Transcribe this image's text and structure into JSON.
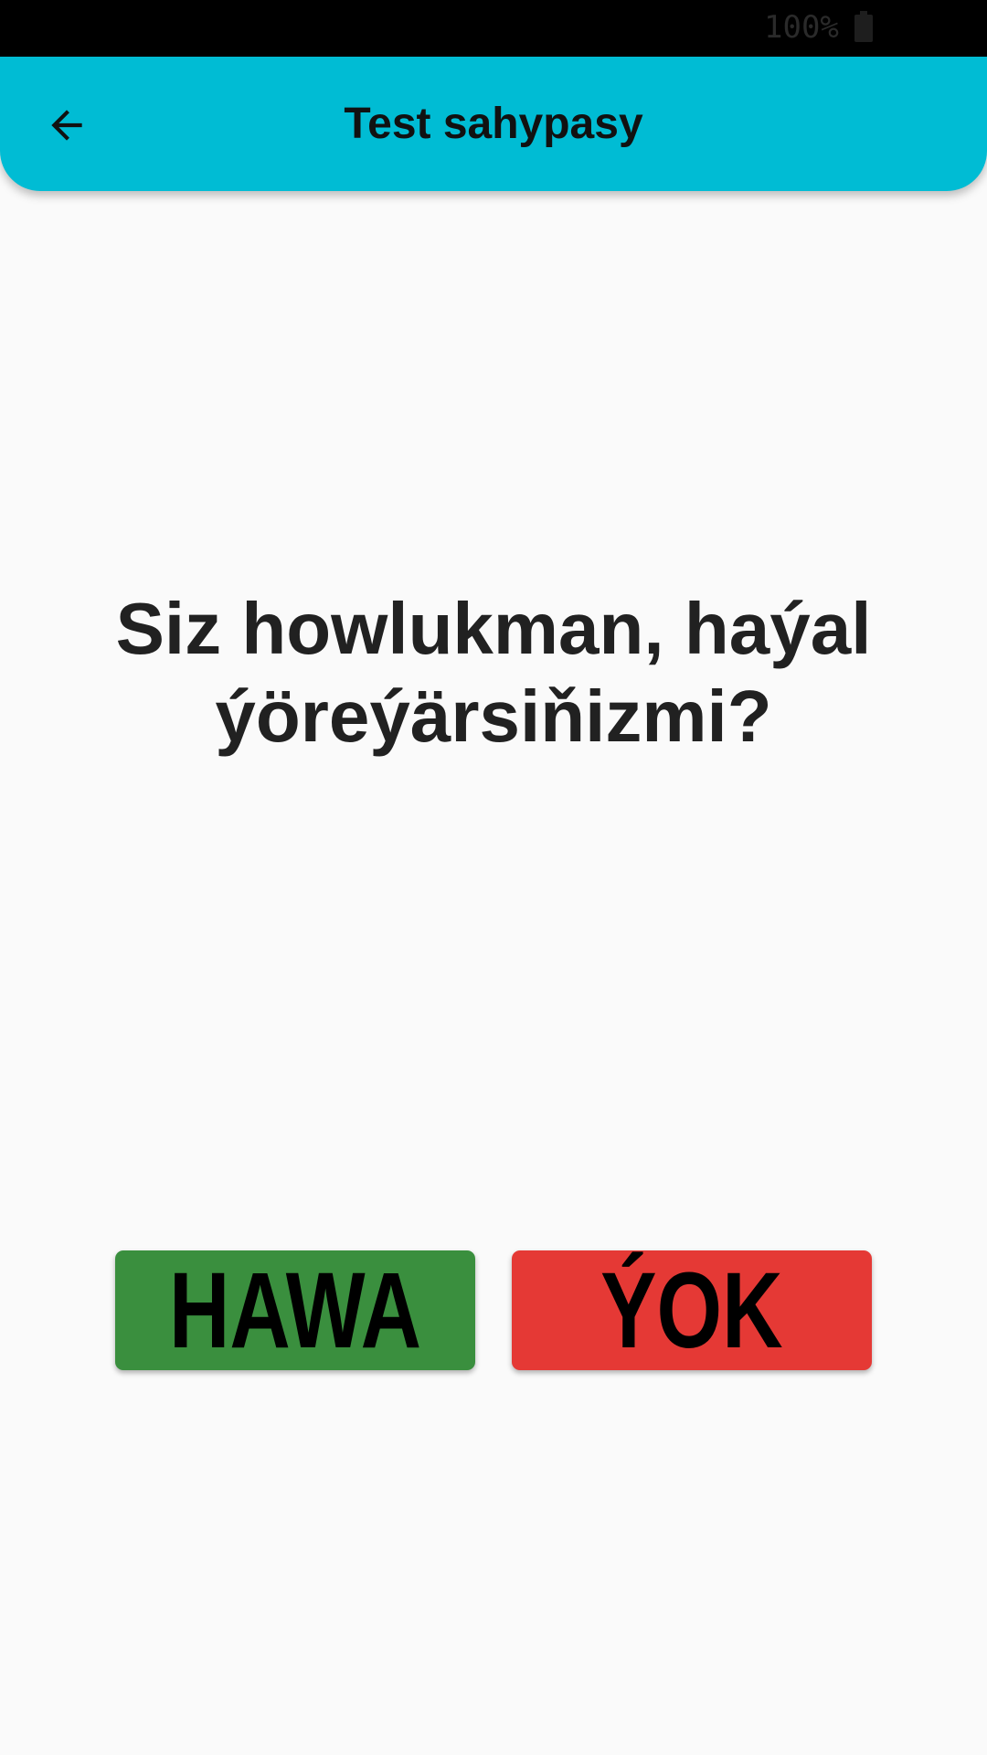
{
  "status_bar": {
    "battery_text": "100%",
    "battery_icon": "battery-full-icon"
  },
  "app_bar": {
    "title": "Test sahypasy",
    "back_icon": "arrow-left-icon",
    "color": "#00bcd4"
  },
  "question": {
    "text": "Siz howlukman, haýal ýöreýärsiňizmi?"
  },
  "answers": {
    "yes": {
      "label": "HAWA",
      "color": "#3a8f3e"
    },
    "no": {
      "label": "ÝOK",
      "color": "#e53935"
    }
  }
}
